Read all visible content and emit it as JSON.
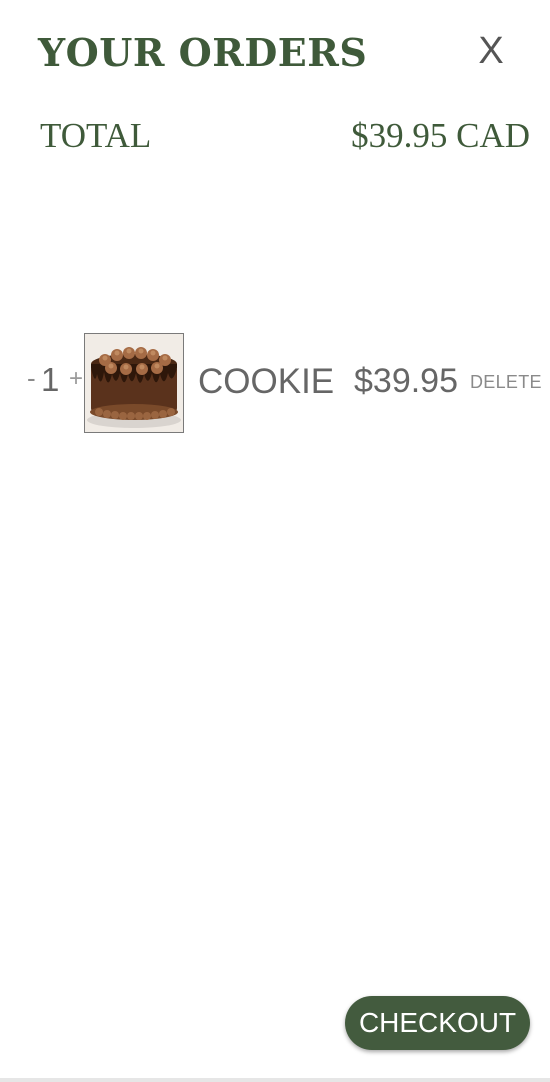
{
  "header": {
    "title": "YOUR ORDERS",
    "close_label": "X"
  },
  "total": {
    "label": "TOTAL",
    "value": "$39.95 CAD"
  },
  "cart": {
    "items": [
      {
        "quantity": "1",
        "minus_label": "-",
        "plus_label": "+",
        "name": "COOKIE",
        "price": "$39.95",
        "delete_label": "DELETE",
        "image_icon": "chocolate-cake-image"
      }
    ]
  },
  "footer": {
    "checkout_label": "CHECKOUT"
  },
  "colors": {
    "brand_green": "#3f5a3a",
    "checkout_bg": "#435b3e",
    "text_gray": "#666666",
    "muted_gray": "#8a8a8a"
  }
}
